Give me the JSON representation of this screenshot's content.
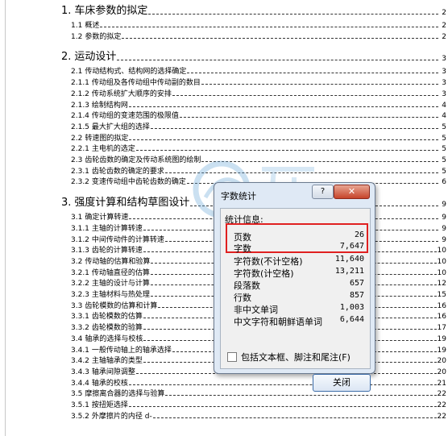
{
  "toc": [
    {
      "level": 1,
      "num": "1.",
      "text": "车床参数的拟定",
      "page": "2"
    },
    {
      "level": 2,
      "num": "1.1",
      "text": "概述",
      "page": "2"
    },
    {
      "level": 2,
      "num": "1.2",
      "text": "参数的拟定",
      "page": "2"
    },
    {
      "level": 1,
      "num": "2.",
      "text": "运动设计",
      "page": "3"
    },
    {
      "level": 2,
      "num": "2.1",
      "text": "传动结构式、结构网的选择确定",
      "page": "3"
    },
    {
      "level": 2,
      "num": "2.1.1",
      "text": "传动组及各传动组中传动副的数目",
      "page": "3"
    },
    {
      "level": 2,
      "num": "2.1.2",
      "text": "传动系统扩大顺序的安排",
      "page": "3"
    },
    {
      "level": 2,
      "num": "2.1.3",
      "text": "绘制结构网",
      "page": "4"
    },
    {
      "level": 2,
      "num": "2.1.4",
      "text": "传动组的变速范围的极限值",
      "page": "4"
    },
    {
      "level": 2,
      "num": "2.1.5",
      "text": "最大扩大组的选择",
      "page": "5"
    },
    {
      "level": 2,
      "num": "2.2",
      "text": "转速图的拟定",
      "page": "5"
    },
    {
      "level": 2,
      "num": "2.2.1",
      "text": "主电机的选定",
      "page": "5"
    },
    {
      "level": 2,
      "num": "2.3",
      "text": "齿轮齿数的确定及传动系统图的绘制",
      "page": "5"
    },
    {
      "level": 2,
      "num": "2.3.1",
      "text": "齿轮齿数的确定的要求",
      "page": "5"
    },
    {
      "level": 2,
      "num": "2.3.2",
      "text": "变速传动组中齿轮齿数的确定",
      "page": "6"
    },
    {
      "level": 1,
      "num": "3.",
      "text": "强度计算和结构草图设计",
      "page": "9"
    },
    {
      "level": 2,
      "num": "3.1",
      "text": "确定计算转速",
      "page": "9"
    },
    {
      "level": 2,
      "num": "3.1.1",
      "text": "主轴的计算转速",
      "page": "9"
    },
    {
      "level": 2,
      "num": "3.1.2",
      "text": "中间传动件的计算转速",
      "page": "9"
    },
    {
      "level": 2,
      "num": "3.1.3",
      "text": "齿轮的计算转速",
      "page": "10"
    },
    {
      "level": 2,
      "num": "3.2",
      "text": "传动轴的估算和验算",
      "page": "10"
    },
    {
      "level": 2,
      "num": "3.2.1",
      "text": "传动轴直径的估算",
      "page": "10"
    },
    {
      "level": 2,
      "num": "3.2.2",
      "text": "主轴的设计与计算",
      "page": "12"
    },
    {
      "level": 2,
      "num": "3.2.3",
      "text": "主轴材料与热处理",
      "page": "15"
    },
    {
      "level": 2,
      "num": "3.3",
      "text": "齿轮模数的估算和计算",
      "page": "16"
    },
    {
      "level": 2,
      "num": "3.3.1",
      "text": "齿轮模数的估算",
      "page": "16"
    },
    {
      "level": 2,
      "num": "3.3.2",
      "text": "齿轮模数的验算",
      "page": "17"
    },
    {
      "level": 2,
      "num": "3.4",
      "text": "轴承的选择与校核",
      "page": "19"
    },
    {
      "level": 2,
      "num": "3.4.1",
      "text": "一般传动轴上的轴承选择",
      "page": "19"
    },
    {
      "level": 2,
      "num": "3.4.2",
      "text": "主轴轴承的类型",
      "page": "20"
    },
    {
      "level": 2,
      "num": "3.4.3",
      "text": "轴承间隙调整",
      "page": "20"
    },
    {
      "level": 2,
      "num": "3.4.4",
      "text": "轴承的校核",
      "page": "21"
    },
    {
      "level": 2,
      "num": "3.5",
      "text": "摩擦离合器的选择与验算",
      "page": "22"
    },
    {
      "level": 2,
      "num": "3.5.1",
      "text": "按扭矩选择",
      "page": "22"
    },
    {
      "level": 2,
      "num": "3.5.2",
      "text": "外摩擦片的内径 d-",
      "page": "22"
    }
  ],
  "dialog": {
    "title": "字数统计",
    "help_label": "?",
    "close_x_label": "✕",
    "stats_header": "统计信息:",
    "stats": [
      {
        "label": "页数",
        "value": "26"
      },
      {
        "label": "字数",
        "value": "7,647"
      },
      {
        "label": "字符数(不计空格)",
        "value": "11,640"
      },
      {
        "label": "字符数(计空格)",
        "value": "13,211"
      },
      {
        "label": "段落数",
        "value": "657"
      },
      {
        "label": "行数",
        "value": "857"
      },
      {
        "label": "非中文单词",
        "value": "1,003"
      },
      {
        "label": "中文字符和朝鲜语单词",
        "value": "6,644"
      }
    ],
    "include_checkbox_label": "包括文本框、脚注和尾注",
    "include_checkbox_accel": "(F)",
    "include_checked": false,
    "close_button_label": "关闭"
  },
  "colors": {
    "highlight_border": "#e02020",
    "dialog_frame": "#dfe9f5",
    "close_x_bg": "#c7442a"
  }
}
